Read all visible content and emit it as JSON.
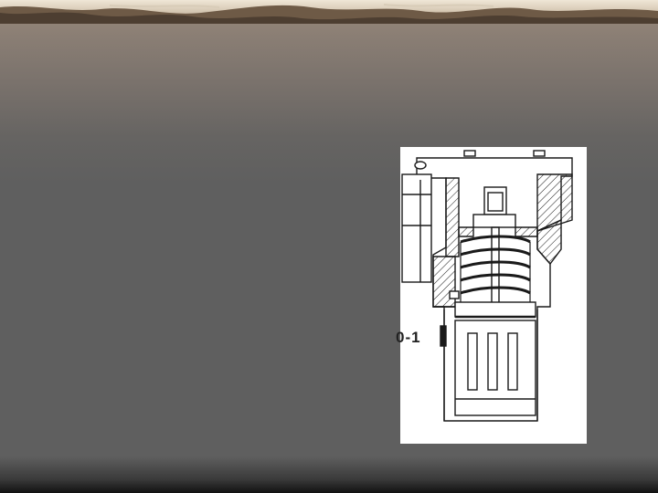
{
  "slide": {
    "figure_label": "0-1"
  },
  "colors": {
    "background": "#5f5f5f",
    "top_band": "#8a7a6a",
    "figure_background": "#ffffff",
    "line": "#1a1a1a"
  },
  "icons": [
    "landscape-banner-image",
    "valve-cross-section-drawing"
  ]
}
